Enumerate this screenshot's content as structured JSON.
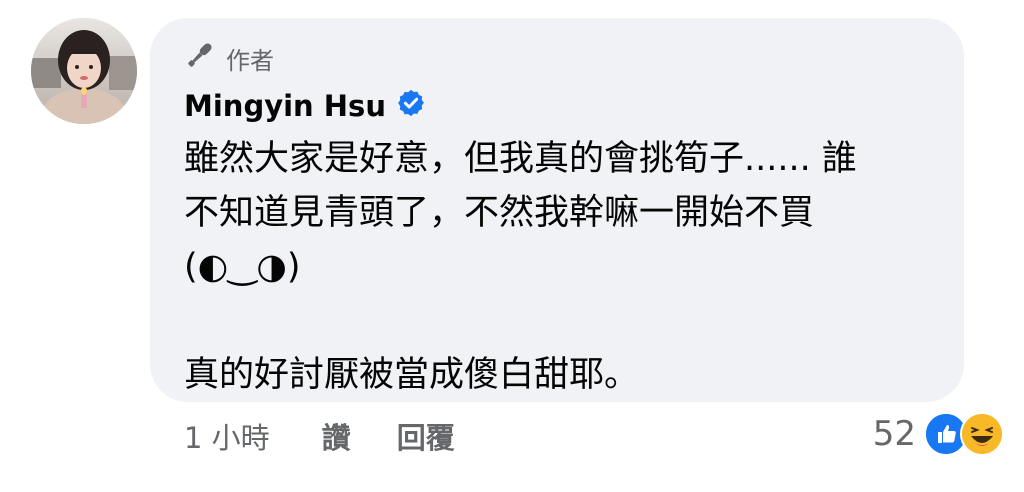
{
  "comment": {
    "author_badge": "作者",
    "author_name": "Mingyin Hsu",
    "text_lines": [
      "雖然大家是好意，但我真的會挑筍子...... 誰",
      "不知道見青頭了，不然我幹嘛一開始不買",
      "(◐‿◑)",
      "",
      "真的好討厭被當成傻白甜耶。"
    ]
  },
  "footer": {
    "time": "1 小時",
    "like_label": "讚",
    "reply_label": "回覆"
  },
  "reactions": {
    "count": "52",
    "icons": [
      "like-reaction-icon",
      "haha-reaction-icon"
    ]
  },
  "colors": {
    "bubble_bg": "#f0f2f5",
    "verified_blue": "#1877f2",
    "secondary_text": "#65676b",
    "haha_yellow": "#f7b928"
  }
}
